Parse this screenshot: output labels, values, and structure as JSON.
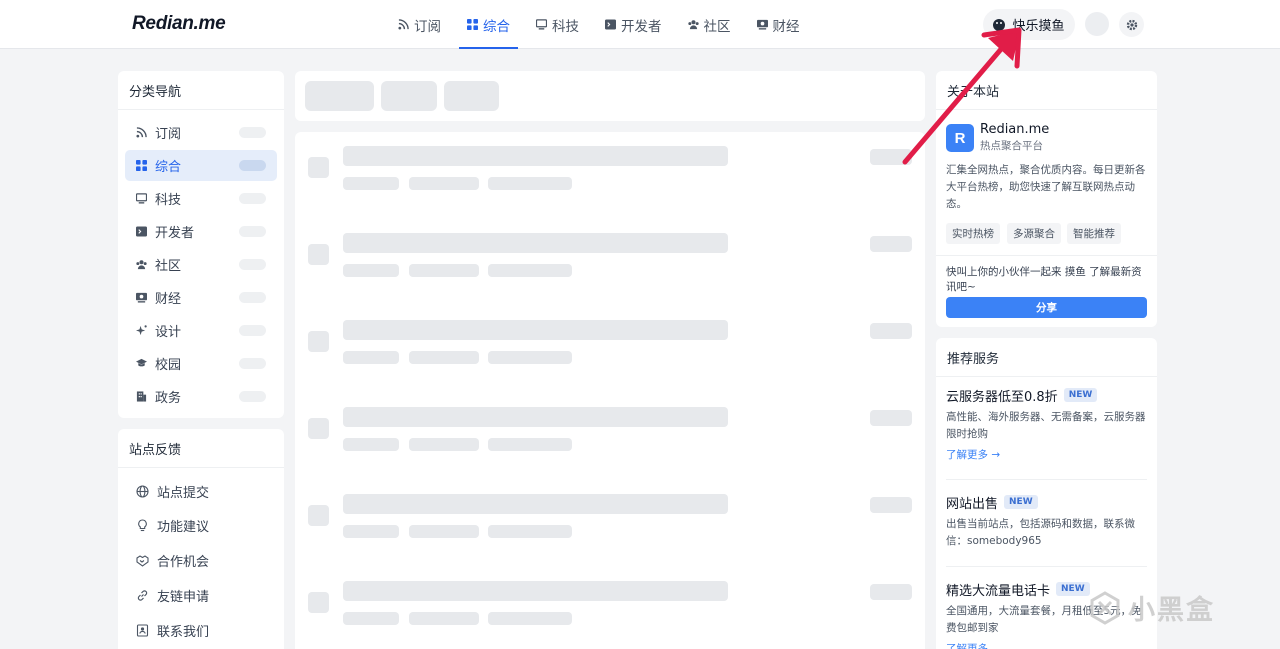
{
  "header": {
    "logo": "Redian.me",
    "nav": [
      {
        "label": "订阅",
        "icon": "rss-icon"
      },
      {
        "label": "综合",
        "icon": "grid-icon",
        "active": true
      },
      {
        "label": "科技",
        "icon": "monitor-icon"
      },
      {
        "label": "开发者",
        "icon": "terminal-icon"
      },
      {
        "label": "社区",
        "icon": "users-icon"
      },
      {
        "label": "财经",
        "icon": "money-icon"
      }
    ],
    "fish_button": "快乐摸鱼"
  },
  "sidebar": {
    "title": "分类导航",
    "items": [
      {
        "label": "订阅",
        "icon": "rss-icon"
      },
      {
        "label": "综合",
        "icon": "grid-icon",
        "active": true
      },
      {
        "label": "科技",
        "icon": "monitor-icon"
      },
      {
        "label": "开发者",
        "icon": "terminal-icon"
      },
      {
        "label": "社区",
        "icon": "users-icon"
      },
      {
        "label": "财经",
        "icon": "money-icon"
      },
      {
        "label": "设计",
        "icon": "sparkle-icon"
      },
      {
        "label": "校园",
        "icon": "graduation-cap-icon"
      },
      {
        "label": "政务",
        "icon": "building-icon"
      }
    ]
  },
  "feedback": {
    "title": "站点反馈",
    "items": [
      {
        "label": "站点提交",
        "icon": "globe-icon"
      },
      {
        "label": "功能建议",
        "icon": "lightbulb-icon"
      },
      {
        "label": "合作机会",
        "icon": "handshake-icon"
      },
      {
        "label": "友链申请",
        "icon": "link-icon"
      },
      {
        "label": "联系我们",
        "icon": "contact-icon"
      }
    ]
  },
  "about": {
    "title": "关于本站",
    "logo_letter": "R",
    "name": "Redian.me",
    "subtitle": "热点聚合平台",
    "description": "汇集全网热点，聚合优质内容。每日更新各大平台热榜，助您快速了解互联网热点动态。",
    "tags": [
      "实时热榜",
      "多源聚合",
      "智能推荐"
    ],
    "share_text": "快叫上你的小伙伴一起来 摸鱼 了解最新资讯吧~",
    "share_button": "分享"
  },
  "services": {
    "title": "推荐服务",
    "items": [
      {
        "title": "云服务器低至0.8折",
        "badge": "NEW",
        "desc": "高性能、海外服务器、无需备案，云服务器限时抢购",
        "more": "了解更多 →"
      },
      {
        "title": "网站出售",
        "badge": "NEW",
        "desc": "出售当前站点，包括源码和数据，联系微信：somebody965",
        "more": ""
      },
      {
        "title": "精选大流量电话卡",
        "badge": "NEW",
        "desc": "全国通用，大流量套餐，月租低至5元，免费包邮到家",
        "more": "了解更多"
      }
    ]
  },
  "watermark": "小黑盒",
  "colors": {
    "accent": "#2563eb",
    "annotation_arrow": "#e11d48"
  }
}
